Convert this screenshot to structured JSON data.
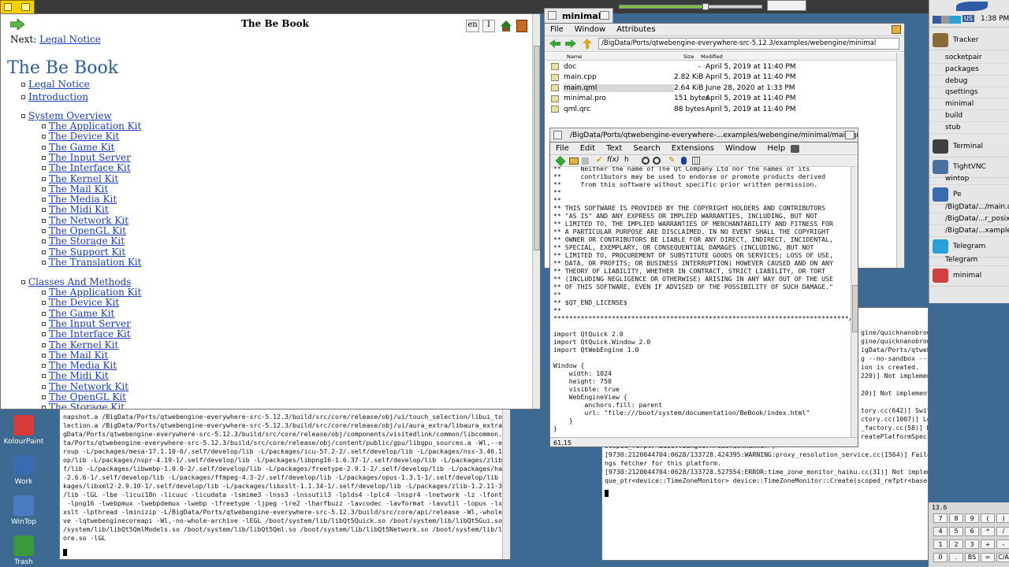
{
  "topbar": {
    "volume_level": 0.6
  },
  "bebook": {
    "title_bar": "The Be Book",
    "next_label": "Next:",
    "next_link": "Legal Notice",
    "lang_button": "en",
    "heading": "The Be Book",
    "top_items": [
      "Legal Notice",
      "Introduction"
    ],
    "section1": "System Overview",
    "kits1": [
      "The Application Kit",
      "The Device Kit",
      "The Game Kit",
      "The Input Server",
      "The Interface Kit",
      "The Kernel Kit",
      "The Mail Kit",
      "The Media Kit",
      "The Midi Kit",
      "The Network Kit",
      "The OpenGL Kit",
      "The Storage Kit",
      "The Support Kit",
      "The Translation Kit"
    ],
    "section2": "Classes And Methods",
    "kits2": [
      "The Application Kit",
      "The Device Kit",
      "The Game Kit",
      "The Input Server",
      "The Interface Kit",
      "The Kernel Kit",
      "The Mail Kit",
      "The Media Kit",
      "The Midi Kit",
      "The Network Kit",
      "The OpenGL Kit",
      "The Storage Kit"
    ]
  },
  "tracker": {
    "title": "minimal",
    "menu": [
      "File",
      "Window",
      "Attributes"
    ],
    "path": "/BigData/Ports/qtwebengine-everywhere-src-5.12.3/examples/webengine/minimal",
    "columns": [
      "Name",
      "Size",
      "Modified"
    ],
    "files": [
      {
        "name": "doc",
        "size": "-",
        "modified": "April 5, 2019 at 11:40 PM"
      },
      {
        "name": "main.cpp",
        "size": "2.82 KiB",
        "modified": "April 5, 2019 at 11:40 PM"
      },
      {
        "name": "main.qml",
        "size": "2.64 KiB",
        "modified": "June 28, 2020 at 1:33 PM"
      },
      {
        "name": "minimal.pro",
        "size": "151 bytes",
        "modified": "April 5, 2019 at 11:40 PM"
      },
      {
        "name": "qml.qrc",
        "size": "88 bytes",
        "modified": "April 5, 2019 at 11:40 PM"
      }
    ]
  },
  "pe": {
    "title": "/BigData/Ports/qtwebengine-everywhere-...examples/webengine/minimal/main.qml",
    "menu": [
      "File",
      "Edit",
      "Text",
      "Search",
      "Extensions",
      "Window",
      "Help"
    ],
    "code": "**     Neither the name of The Qt Company Ltd nor the names of its\n**     contributors may be used to endorse or promote products derived\n**     from this software without specific prior written permission.\n**\n**\n** THIS SOFTWARE IS PROVIDED BY THE COPYRIGHT HOLDERS AND CONTRIBUTORS\n** \"AS IS\" AND ANY EXPRESS OR IMPLIED WARRANTIES, INCLUDING, BUT NOT\n** LIMITED TO, THE IMPLIED WARRANTIES OF MERCHANTABILITY AND FITNESS FOR\n** A PARTICULAR PURPOSE ARE DISCLAIMED. IN NO EVENT SHALL THE COPYRIGHT\n** OWNER OR CONTRIBUTORS BE LIABLE FOR ANY DIRECT, INDIRECT, INCIDENTAL,\n** SPECIAL, EXEMPLARY, OR CONSEQUENTIAL DAMAGES (INCLUDING, BUT NOT\n** LIMITED TO, PROCUREMENT OF SUBSTITUTE GOODS OR SERVICES; LOSS OF USE,\n** DATA, OR PROFITS; OR BUSINESS INTERRUPTION) HOWEVER CAUSED AND ON ANY\n** THEORY OF LIABILITY, WHETHER IN CONTRACT, STRICT LIABILITY, OR TORT\n** (INCLUDING NEGLIGENCE OR OTHERWISE) ARISING IN ANY WAY OUT OF THE USE\n** OF THIS SOFTWARE, EVEN IF ADVISED OF THE POSSIBILITY OF SUCH DAMAGE.\"\n**\n** $QT_END_LICENSE$\n**\n****************************************************************************/\n\nimport QtQuick 2.0\nimport QtQuick.Window 2.0\nimport QtWebEngine 1.0\n\nWindow {\n    width: 1024\n    height: 750\n    visible: true\n    WebEngineView {\n        anchors.fill: parent\n        url: \"file:///boot/system/documentation/BeBook/index.html\"\n    }\n}",
    "status": "61,15"
  },
  "terminal_left": {
    "text": "napshot.a /BigData/Ports/qtwebengine-everywhere-src-5.12.3/build/src/core/release/obj/ui/touch_selection/libui_touch_se\nlection.a /BigData/Ports/qtwebengine-everywhere-src-5.12.3/build/src/core/release/obj/ui/aura_extra/libaura_extra.a /Bi\ngData/Ports/qtwebengine-everywhere-src-5.12.3/build/src/core/release/obj/components/visitedlink/common/libcommon.a /BigDa\nta/Ports/qtwebengine-everywhere-src-5.12.3/build/src/core/release/obj/content/public/gpu/libgpu_sources.a -Wl,--end-g\nroup -L/packages/mesa-17.1.10-6/.self/develop/lib -L/packages/icu-57.2-2/.self/develop/lib -L/packages/nss-3.46.1-1/.self/devel\nop/lib -L/packages/nspr-4.19-1/.self/develop/lib -L/packages/libpng16-1.6.37-1/.self/develop/lib -L/packages/zlib-1.2.11-4/.sel\nf/lib -L/packages/libwebp-1.0.0-2/.self/develop/lib -L/packages/freetype-2.9.1-2/.self/develop/lib -L/packages/harfbuzz\n-2.6.6-1/.self/develop/lib -L/packages/ffmpeg-4.3-2/.self/develop/lib -L/packages/opus-1.3.1-1/.self/develop/lib -L/pac\nkages/libxml2-2.9.10-1/.self/develop/lib -L/packages/libxslt-1.1.34-1/.self/develop/lib -L/packages/zlib-1.2.11-3/.self\n/lib -lGL -lbe -licui18n -licuuc -licudata -lsmime3 -lnss3 -lnssutil3 -lplds4 -lplc4 -lnspr4 -lnetwork -lz -lfontconfig\n -lpng16 -lwebpmux -lwebpdemux -lwebp -lfreetype -ljpeg -lre2 -lharfbuzz -lavcodec -lavformat -lavutil -lopus -lxml2 -l\nxslt -lpthread -lminizip -L/BigData/Ports/qtwebengine-everywhere-src-5.12.3/build/src/core/api/release -Wl,-whole-archi\nve -lqtwebenginecoreapi -Wl,-no-whole-archive -lEGL /boot/system/lib/libQt5Quick.so /boot/system/lib/libQt5Gui.so /boot\n/system/lib/libQt5QmlModels.so /boot/system/lib/libQt5Qml.so /boot/system/lib/libQt5Network.so /boot/system/lib/libQt5C\nore.so -lGL"
  },
  "terminal_right": {
    "text_top": "gine/quicknanobrowser>\ngine/quicknanobrowser> QTWEBENGINE_CHROMI\nigData/Ports/qtwebengine-everywhere-src-5.\ng --no-sandbox --single-process\nion is created.\n220)] Not implemented reached in static n\n\n20)] Not implemented reached in static ne\n\ntory.cc(642)] Switching to software composi\nctory.cc(1007)] Lost UI shared context.\n_factory.cc(58)] Not implemented reached\nreatePlatformSpecificVideoCaptureDeviceFac",
    "text_bottom": "scoped_refptr<base::SingleThreadTaskRunner>)\n[9730:2120044704:0628/133728.424395:WARNING:proxy_resolution_service.cc(1564)] Failed to choose a system proxy\nngs fetcher for this platform.\n[9730:2120044704:0628/133728.527554:ERROR:time_zone_monitor_haiku.cc(31)] Not implemented reached in static st\nque_ptr<device::TimeZoneMonitor> device::TimeZoneMonitor::Create(scoped_refptr<base::SequencedTaskRunner>)"
  },
  "deskbar": {
    "lang": "US",
    "clock": "1:38 PM",
    "apps": [
      {
        "label": "Tracker",
        "color": "#8a6a3a"
      },
      {
        "label": "Terminal",
        "color": "#404040"
      },
      {
        "label": "TightVNC",
        "color": "#4a6fa0"
      },
      {
        "label": "Pe",
        "color": "#3a6ab0"
      },
      {
        "label": "Telegram",
        "color": "#2aa0d8"
      },
      {
        "label": "minimal",
        "color": "#d04040"
      }
    ],
    "tracker_windows": [
      "socketpair",
      "packages",
      "debug",
      "qsettings",
      "minimal",
      "build",
      "stub"
    ],
    "terminal_windows": [
      "wintop"
    ],
    "pe_windows": [
      "/BigData/.../main.qml",
      "/BigData/...r_posix.cc",
      "/BigData/...xample.c"
    ],
    "telegram_windows": [
      "Telegram"
    ]
  },
  "desktop_icons": [
    "KolourPaint",
    "Work",
    "WinTop",
    "Trash"
  ],
  "calculator": {
    "display": "13.6",
    "keys": [
      "7",
      "8",
      "9",
      "(",
      ")",
      "4",
      "5",
      "6",
      "*",
      "/",
      "1",
      "2",
      "3",
      "+",
      "-",
      "0",
      ".",
      "BS",
      "=",
      "C/A"
    ]
  }
}
